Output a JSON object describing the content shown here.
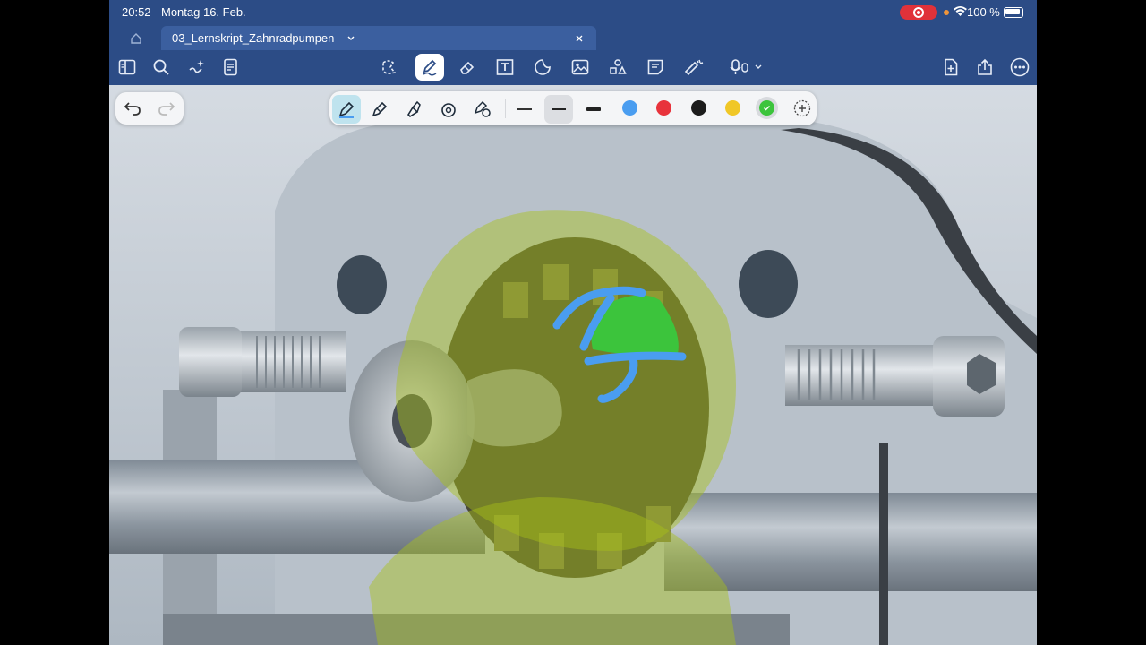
{
  "status": {
    "time": "20:52",
    "date": "Montag 16. Feb.",
    "battery": "100 %"
  },
  "tab": {
    "title": "03_Lernskript_Zahnradpumpen"
  },
  "colors": {
    "topbar": "#2c4c86",
    "tab": "#3b5f9f",
    "blue_ink": "#4a9df0",
    "green_ink": "#3cc43c",
    "highlighter": "#a8c018"
  },
  "palette": [
    "#4a9df0",
    "#e8333c",
    "#1c1c1c",
    "#f0c727",
    "#3cc43c"
  ],
  "toolbar_icons": [
    "sidebar-icon",
    "search-icon",
    "sparkle-icon",
    "document-icon",
    "lasso-icon",
    "pen-icon",
    "eraser-icon",
    "text-box-icon",
    "sticker-icon",
    "image-icon",
    "shapes-icon",
    "note-icon",
    "laser-pointer-icon",
    "microphone-icon",
    "add-page-icon",
    "share-icon",
    "more-icon"
  ]
}
